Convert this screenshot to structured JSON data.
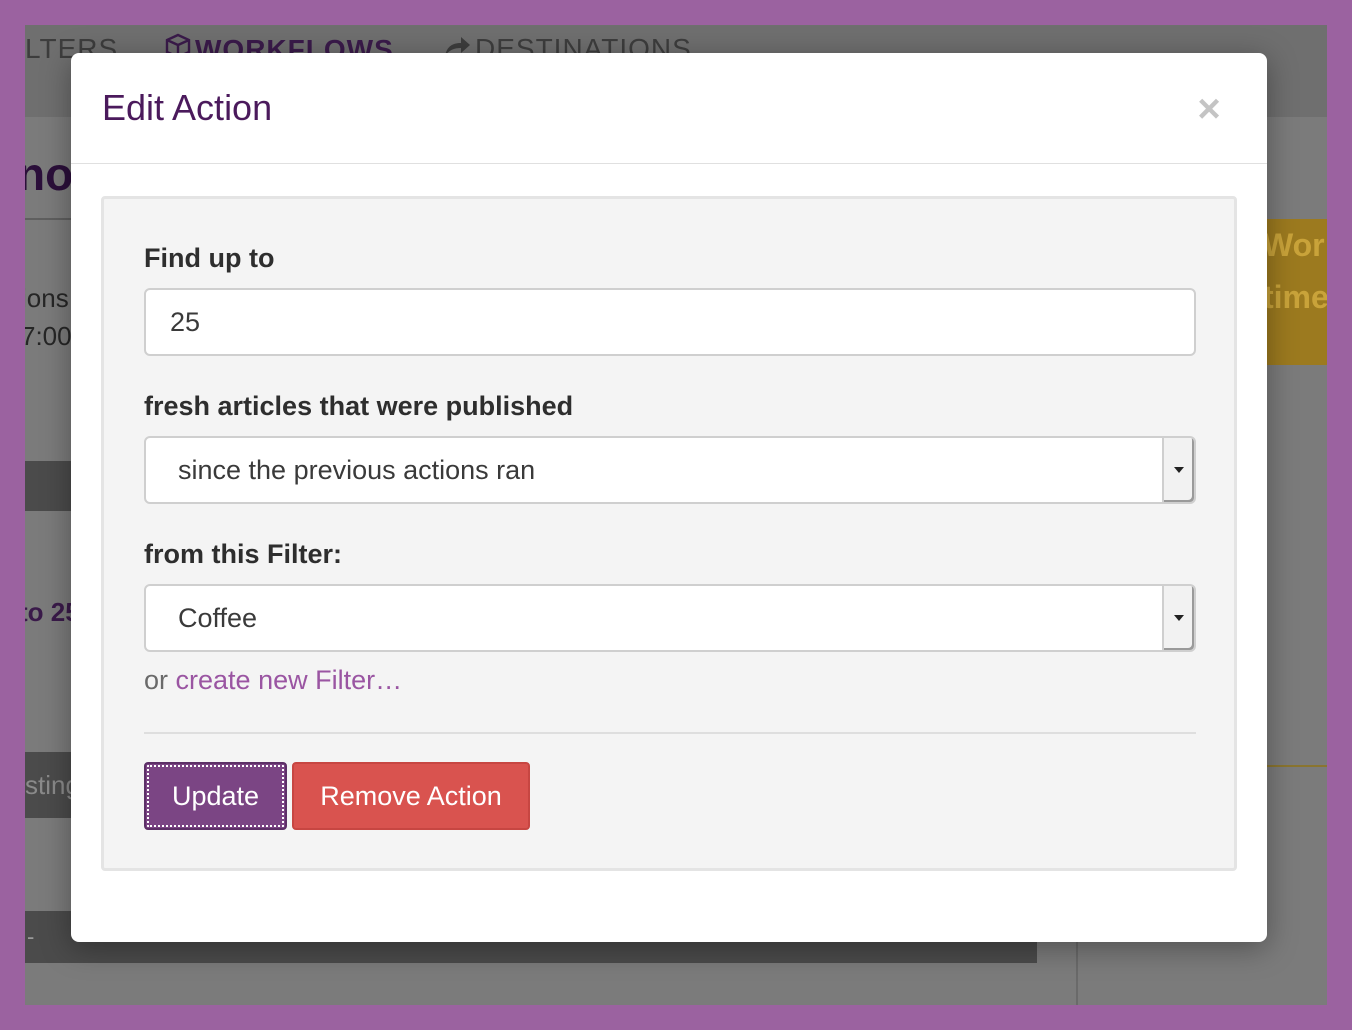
{
  "background": {
    "nav_tabs": [
      {
        "label": "LTERS"
      },
      {
        "label": "WORKFLOWS"
      },
      {
        "label": "DESTINATIONS"
      }
    ],
    "heading_fragment": "no",
    "text_fragment_1": "ions",
    "text_fragment_2": "7:00",
    "purple_fragment": "to 25",
    "button_fragment": "sting",
    "dash_fragment": "-",
    "alert_line_1": "Wor",
    "alert_line_2": "time"
  },
  "modal": {
    "title": "Edit Action",
    "close_label": "×",
    "form": {
      "find_label": "Find up to",
      "find_value": "25",
      "published_label": "fresh articles that were published",
      "published_value": "since the previous actions ran",
      "filter_label": "from this Filter:",
      "filter_value": "Coffee",
      "or_text": "or",
      "create_link": "create new Filter…"
    },
    "buttons": {
      "update": "Update",
      "remove": "Remove Action"
    }
  },
  "colors": {
    "page_border": "#9b62a0",
    "title": "#4b1a5c",
    "link": "#9a55a2",
    "update_button": "#7b4584",
    "remove_button": "#d9534f"
  }
}
